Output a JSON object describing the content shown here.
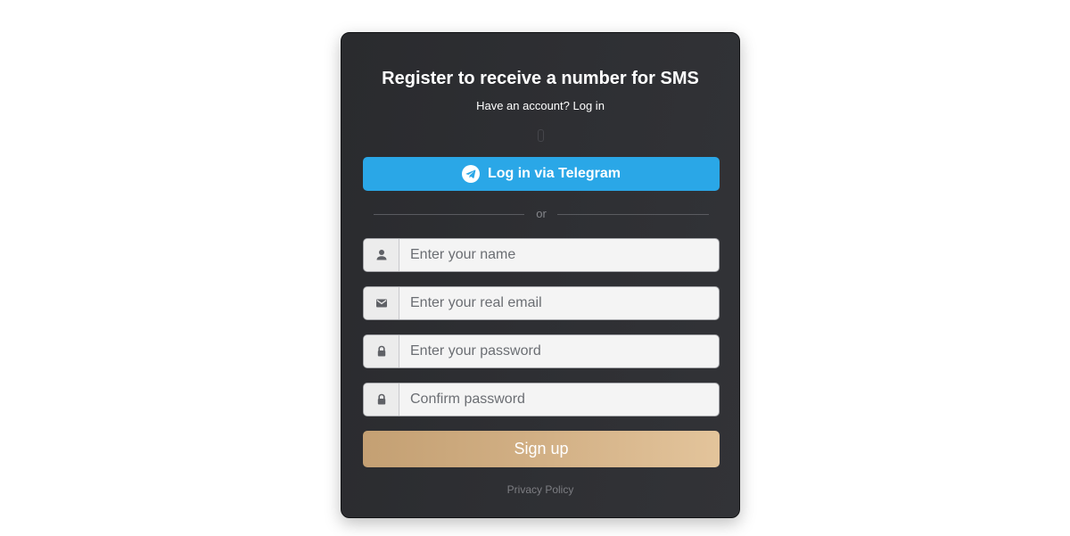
{
  "form": {
    "title": "Register to receive a number for SMS",
    "have_account_text": "Have an account?",
    "login_link": "Log in",
    "telegram_button": "Log in via Telegram",
    "divider_text": "or",
    "fields": {
      "name": {
        "placeholder": "Enter your name",
        "icon": "person-icon"
      },
      "email": {
        "placeholder": "Enter your real email",
        "icon": "envelope-icon"
      },
      "password": {
        "placeholder": "Enter your password",
        "icon": "lock-icon"
      },
      "confirm": {
        "placeholder": "Confirm password",
        "icon": "lock-icon"
      }
    },
    "signup_button": "Sign up",
    "privacy_link": "Privacy Policy"
  },
  "colors": {
    "card_background": "#2e2f33",
    "telegram_blue": "#2aa7e7",
    "signup_gradient_start": "#c4a073",
    "signup_gradient_end": "#e3c49b",
    "input_background": "#f4f4f4"
  }
}
